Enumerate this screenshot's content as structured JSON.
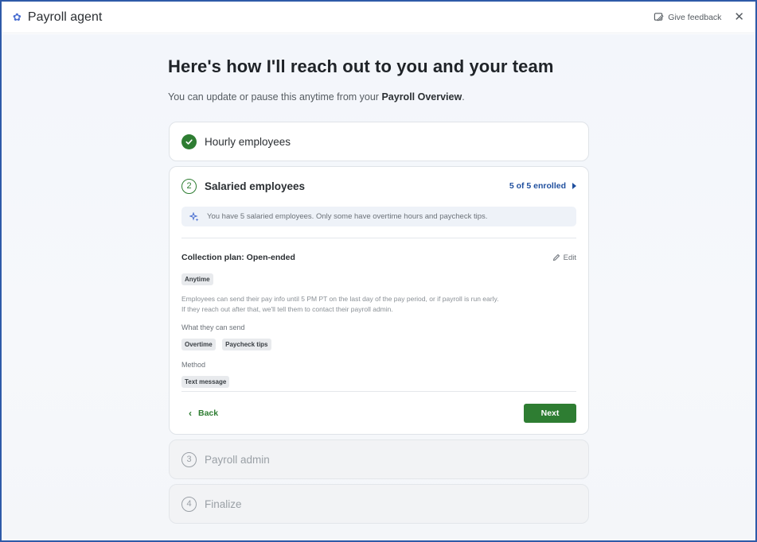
{
  "app": {
    "title": "Payroll agent",
    "feedback_label": "Give feedback",
    "close_symbol": "✕"
  },
  "header": {
    "title": "Here's how I'll reach out to you and your team",
    "subtitle_prefix": "You can update or pause this anytime from your ",
    "subtitle_link": "Payroll Overview",
    "subtitle_suffix": "."
  },
  "steps": [
    {
      "number": "",
      "label": "Hourly employees",
      "state": "complete"
    },
    {
      "number": "2",
      "label": "Salaried employees",
      "state": "active",
      "status": "5 of 5 enrolled"
    },
    {
      "number": "3",
      "label": "Payroll admin",
      "state": "pending"
    },
    {
      "number": "4",
      "label": "Finalize",
      "state": "pending"
    }
  ],
  "active_step": {
    "info": "You have 5 salaried employees. Only some have overtime hours and paycheck tips.",
    "plan_title": "Collection plan: Open-ended",
    "edit_label": "Edit",
    "timing_chip": "Anytime",
    "description": "Employees can send their pay info until 5 PM PT on the last day of the pay period, or if payroll is run early. If they reach out after that, we'll tell them to contact their payroll admin.",
    "send_label": "What they can send",
    "send_chips": [
      "Overtime",
      "Paycheck tips"
    ],
    "method_label": "Method",
    "method_chips": [
      "Text message"
    ],
    "back_label": "Back",
    "next_label": "Next"
  },
  "colors": {
    "accent_green": "#2e7d32",
    "link_blue": "#1f4f9e",
    "frame_blue": "#2e5aa8"
  },
  "icons": [
    "star-icon",
    "feedback-icon",
    "close-icon",
    "check-icon",
    "sparkle-icon",
    "pencil-icon",
    "chevron-left-icon",
    "caret-right-icon"
  ]
}
